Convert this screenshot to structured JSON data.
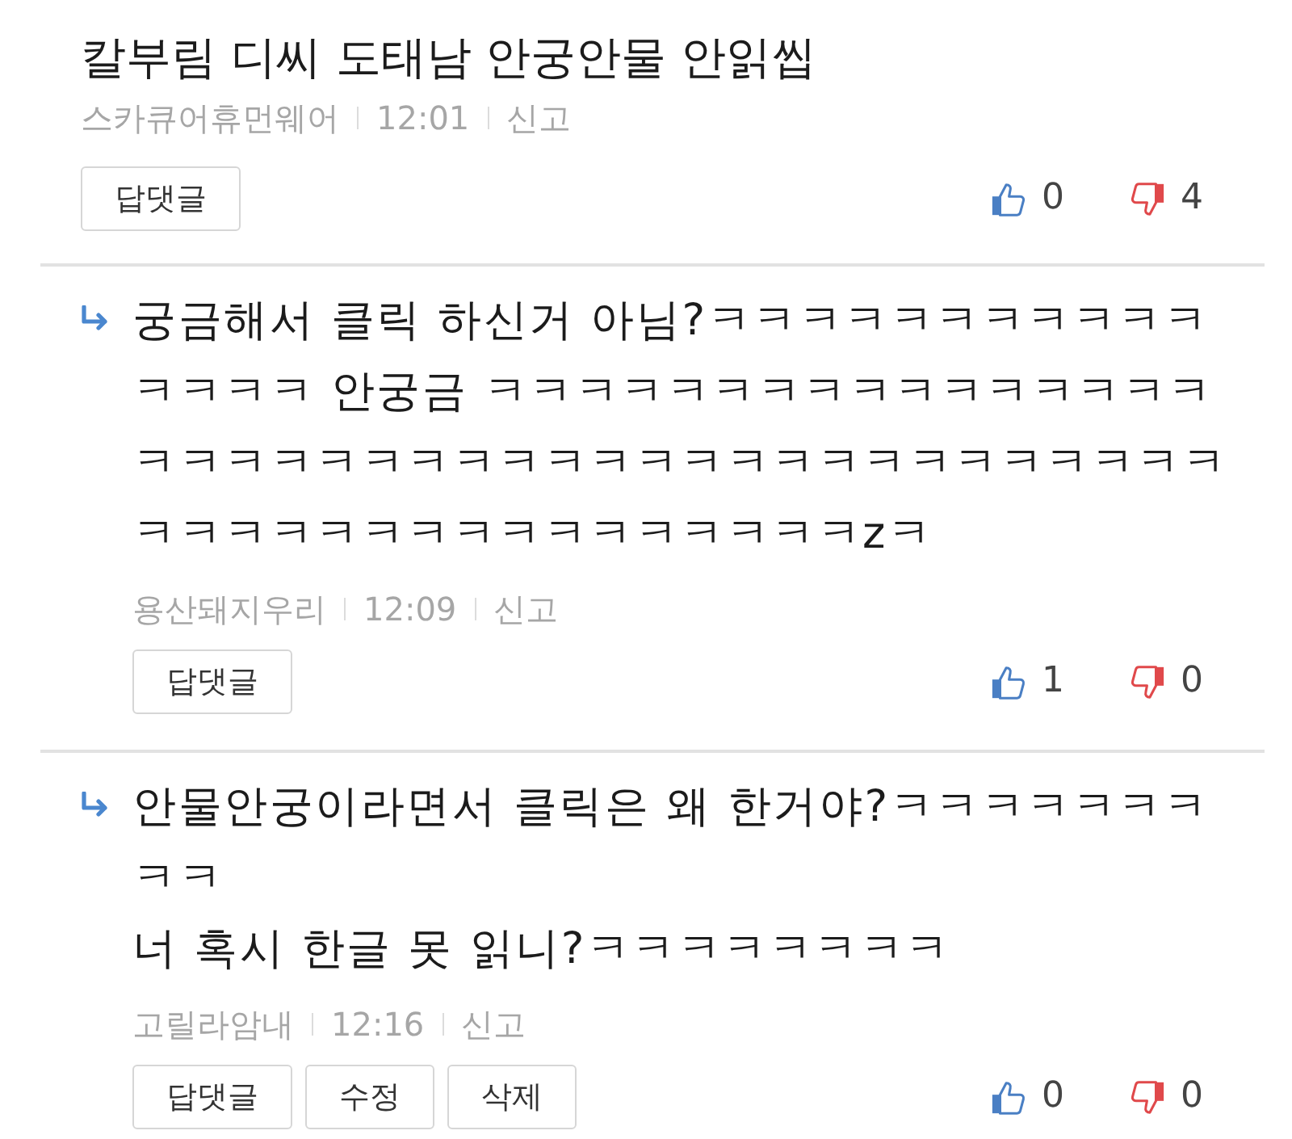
{
  "comments": [
    {
      "kind": "parent",
      "paragraphs": [
        "칼부림 디씨 도태남 안궁안물 안읽씹"
      ],
      "author": "스카큐어휴먼웨어",
      "time": "12:01",
      "report": "신고",
      "buttons": [
        "답댓글"
      ],
      "likes": "0",
      "dislikes": "4"
    },
    {
      "kind": "reply",
      "paragraphs": [
        "궁금해서 클릭 하신거 아님?ㅋㅋㅋㅋㅋㅋㅋㅋㅋㅋㅋㅋㅋㅋㅋ 안궁금 ㅋㅋㅋㅋㅋㅋㅋㅋㅋㅋㅋㅋㅋㅋㅋㅋㅋㅋㅋㅋㅋㅋㅋㅋㅋㅋㅋㅋㅋㅋㅋㅋㅋㅋㅋㅋㅋㅋㅋㅋㅋㅋㅋㅋㅋㅋㅋㅋㅋㅋㅋㅋㅋㅋㅋㅋzㅋ"
      ],
      "author": "용산돼지우리",
      "time": "12:09",
      "report": "신고",
      "buttons": [
        "답댓글"
      ],
      "likes": "1",
      "dislikes": "0"
    },
    {
      "kind": "reply",
      "paragraphs": [
        "안물안궁이라면서 클릭은 왜 한거야?ㅋㅋㅋㅋㅋㅋㅋㅋㅋ",
        "너 혹시 한글 못 읽니?ㅋㅋㅋㅋㅋㅋㅋㅋ"
      ],
      "author": "고릴라암내",
      "time": "12:16",
      "report": "신고",
      "buttons": [
        "답댓글",
        "수정",
        "삭제"
      ],
      "likes": "0",
      "dislikes": "0"
    }
  ]
}
